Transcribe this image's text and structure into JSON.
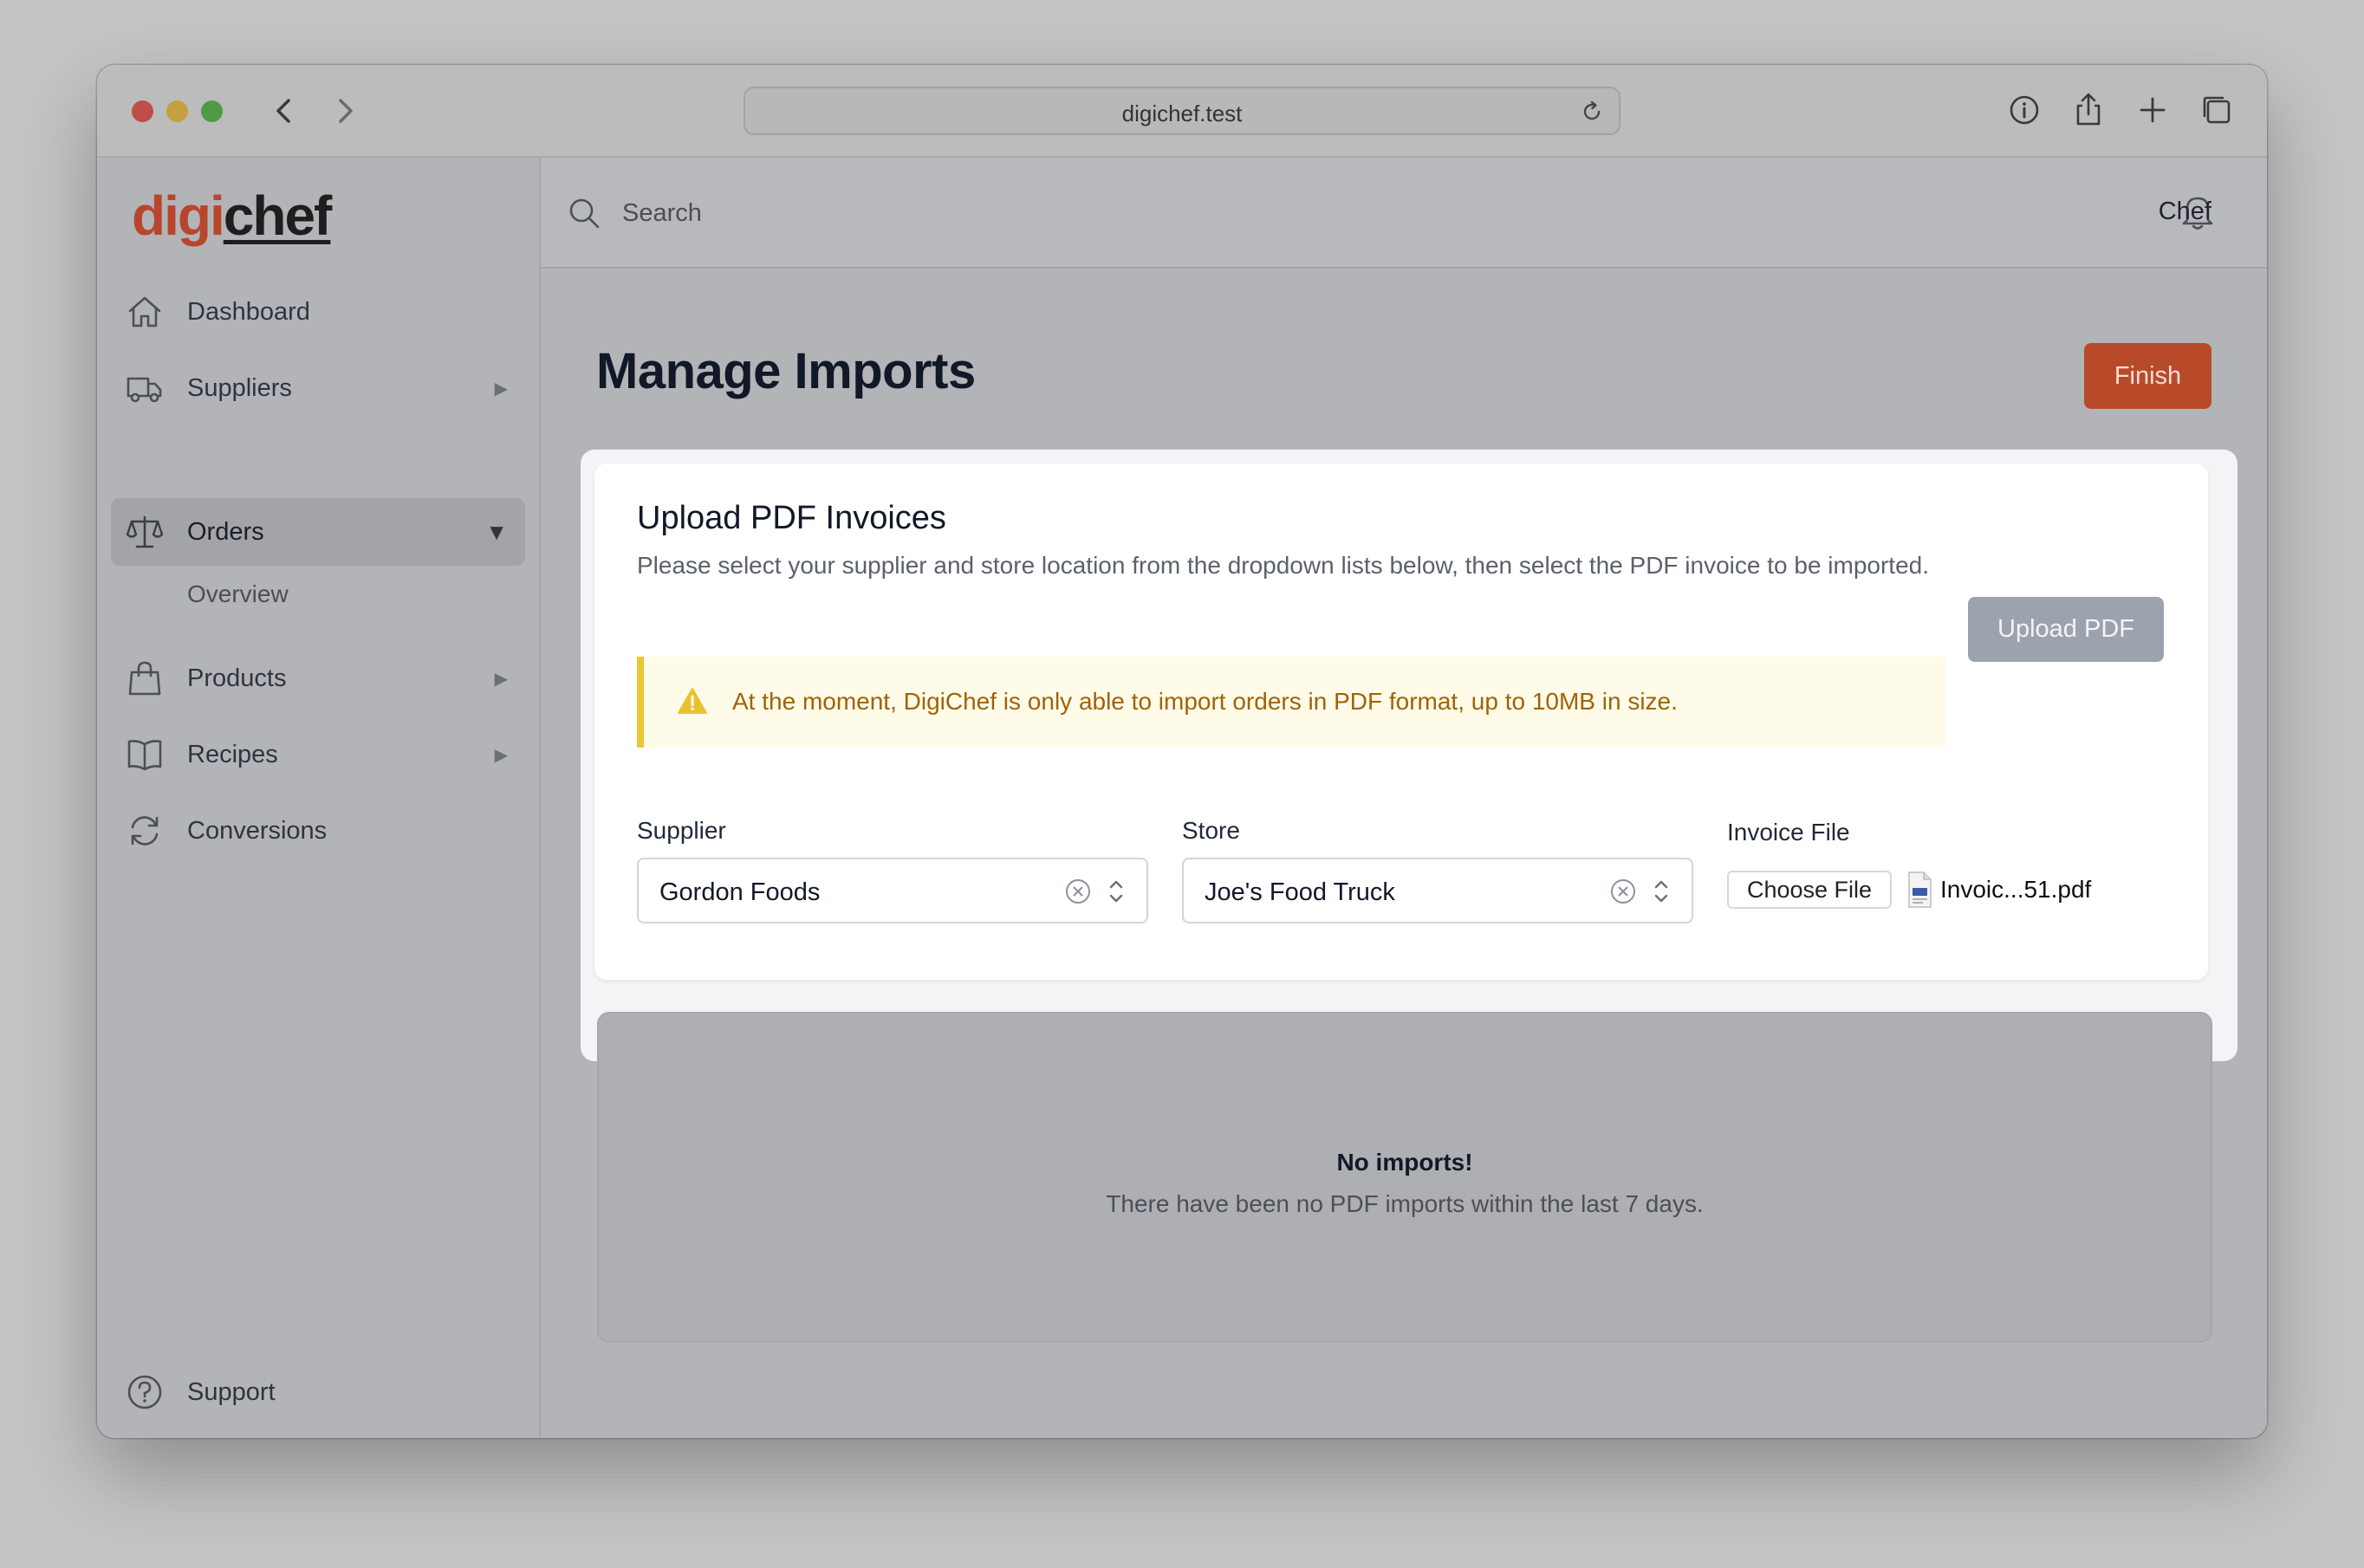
{
  "browser": {
    "url": "digichef.test"
  },
  "brand": {
    "logo_part1": "digi",
    "logo_part2": "chef",
    "accent_color": "#b8462d"
  },
  "sidebar": {
    "items": [
      {
        "label": "Dashboard",
        "icon": "home-icon",
        "has_caret": false
      },
      {
        "label": "Suppliers",
        "icon": "truck-icon",
        "has_caret": true
      },
      {
        "label": "Orders",
        "icon": "scales-icon",
        "has_caret": true,
        "active": true
      },
      {
        "label": "Products",
        "icon": "shopping-bag-icon",
        "has_caret": true
      },
      {
        "label": "Recipes",
        "icon": "book-icon",
        "has_caret": true
      },
      {
        "label": "Conversions",
        "icon": "refresh-icon",
        "has_caret": false
      }
    ],
    "sub_item": "Overview",
    "support_label": "Support",
    "caret_collapsed": "▶",
    "caret_expanded": "▼"
  },
  "topbar": {
    "search_placeholder": "Search",
    "user_name": "Chef"
  },
  "page": {
    "title": "Manage Imports",
    "finish_label": "Finish"
  },
  "upload": {
    "title": "Upload PDF Invoices",
    "description": "Please select your supplier and store location from the dropdown lists below, then select the PDF invoice to be imported.",
    "upload_button": "Upload PDF",
    "alert": "At the moment, DigiChef is only able to import orders in PDF format, up to 10MB in size.",
    "supplier_label": "Supplier",
    "supplier_value": "Gordon Foods",
    "store_label": "Store",
    "store_value": "Joe's Food Truck",
    "file_label": "Invoice File",
    "choose_file": "Choose File",
    "file_name": "Invoic...51.pdf"
  },
  "imports": {
    "empty_title": "No imports!",
    "empty_desc": "There have been no PDF imports within the last 7 days."
  }
}
